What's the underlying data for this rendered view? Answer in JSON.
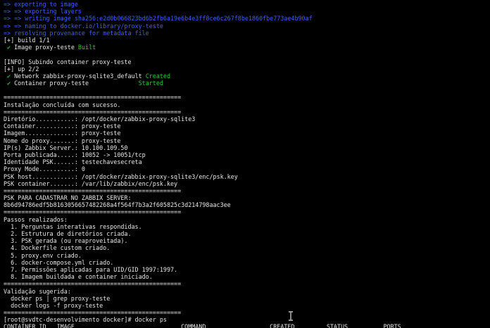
{
  "terminal": {
    "lines": [
      {
        "segments": [
          {
            "t": "=> exporting to image",
            "c": "blue"
          }
        ]
      },
      {
        "segments": [
          {
            "t": "=> => exporting layers",
            "c": "blue"
          }
        ]
      },
      {
        "segments": [
          {
            "t": "=> => writing image sha256:e2d0b066823bd6b2fb6a19e6b4e3ff8ce6c267f8be1860fbe773ae4b90af",
            "c": "blue"
          }
        ]
      },
      {
        "segments": [
          {
            "t": "=> => naming to docker.io/library/proxy-teste",
            "c": "blue"
          }
        ]
      },
      {
        "segments": [
          {
            "t": "=> resolving provenance for metadata file",
            "c": "blue"
          }
        ]
      },
      {
        "segments": [
          {
            "t": "[+] build 1/1",
            "c": "white"
          }
        ]
      },
      {
        "segments": [
          {
            "t": " ✔ ",
            "c": "check"
          },
          {
            "t": "Image proxy-teste ",
            "c": "white"
          },
          {
            "t": "Built",
            "c": "green"
          }
        ]
      },
      {
        "segments": [
          {
            "t": "",
            "c": "white"
          }
        ]
      },
      {
        "segments": [
          {
            "t": "[INFO] Subindo container proxy-teste",
            "c": "white"
          }
        ]
      },
      {
        "segments": [
          {
            "t": "[+] up 2/2",
            "c": "white"
          }
        ]
      },
      {
        "segments": [
          {
            "t": " ✔ ",
            "c": "check"
          },
          {
            "t": "Network zabbix-proxy-sqlite3_default ",
            "c": "white"
          },
          {
            "t": "Created",
            "c": "green"
          }
        ]
      },
      {
        "segments": [
          {
            "t": " ✔ ",
            "c": "check"
          },
          {
            "t": "Container proxy-teste              ",
            "c": "white"
          },
          {
            "t": "Started",
            "c": "green"
          }
        ]
      },
      {
        "segments": [
          {
            "t": "",
            "c": "white"
          }
        ]
      },
      {
        "segments": [
          {
            "t": "==================================================",
            "c": "white"
          }
        ]
      },
      {
        "segments": [
          {
            "t": "Instalação concluída com sucesso.",
            "c": "white"
          }
        ]
      },
      {
        "segments": [
          {
            "t": "==================================================",
            "c": "white"
          }
        ]
      },
      {
        "segments": [
          {
            "t": "Diretório...........: /opt/docker/zabbix-proxy-sqlite3",
            "c": "white"
          }
        ]
      },
      {
        "segments": [
          {
            "t": "Container...........: proxy-teste",
            "c": "white"
          }
        ]
      },
      {
        "segments": [
          {
            "t": "Imagem..............: proxy-teste",
            "c": "white"
          }
        ]
      },
      {
        "segments": [
          {
            "t": "Nome do proxy.......: proxy-teste",
            "c": "white"
          }
        ]
      },
      {
        "segments": [
          {
            "t": "IP(s) Zabbix Server.: 10.100.109.50",
            "c": "white"
          }
        ]
      },
      {
        "segments": [
          {
            "t": "Porta publicada.....: 10052 -> 10051/tcp",
            "c": "white"
          }
        ]
      },
      {
        "segments": [
          {
            "t": "Identidade PSK......: testechavesecreta",
            "c": "white"
          }
        ]
      },
      {
        "segments": [
          {
            "t": "Proxy Mode..........: 0",
            "c": "white"
          }
        ]
      },
      {
        "segments": [
          {
            "t": "PSK host............: /opt/docker/zabbix-proxy-sqlite3/enc/psk.key",
            "c": "white"
          }
        ]
      },
      {
        "segments": [
          {
            "t": "PSK container.......: /var/lib/zabbix/enc/psk.key",
            "c": "white"
          }
        ]
      },
      {
        "segments": [
          {
            "t": "==================================================",
            "c": "white"
          }
        ]
      },
      {
        "segments": [
          {
            "t": "PSK PARA CADASTRAR NO ZABBIX SERVER:",
            "c": "white"
          }
        ]
      },
      {
        "segments": [
          {
            "t": "8b6d94786edf5b8163056657482268a4f564f7b3a2f605825c3d214798aac3ee",
            "c": "white"
          }
        ]
      },
      {
        "segments": [
          {
            "t": "==================================================",
            "c": "white"
          }
        ]
      },
      {
        "segments": [
          {
            "t": "Passos realizados:",
            "c": "white"
          }
        ]
      },
      {
        "segments": [
          {
            "t": "  1. Perguntas interativas respondidas.",
            "c": "white"
          }
        ]
      },
      {
        "segments": [
          {
            "t": "  2. Estrutura de diretórios criada.",
            "c": "white"
          }
        ]
      },
      {
        "segments": [
          {
            "t": "  3. PSK gerada (ou reaproveitada).",
            "c": "white"
          }
        ]
      },
      {
        "segments": [
          {
            "t": "  4. Dockerfile custom criado.",
            "c": "white"
          }
        ]
      },
      {
        "segments": [
          {
            "t": "  5. proxy.env criado.",
            "c": "white"
          }
        ]
      },
      {
        "segments": [
          {
            "t": "  6. docker-compose.yml criado.",
            "c": "white"
          }
        ]
      },
      {
        "segments": [
          {
            "t": "  7. Permissões aplicadas para UID/GID 1997:1997.",
            "c": "white"
          }
        ]
      },
      {
        "segments": [
          {
            "t": "  8. Imagem buildada e container iniciado.",
            "c": "white"
          }
        ]
      },
      {
        "segments": [
          {
            "t": "==================================================",
            "c": "white"
          }
        ]
      },
      {
        "segments": [
          {
            "t": "Validação sugerida:",
            "c": "white"
          }
        ]
      },
      {
        "segments": [
          {
            "t": "  docker ps | grep proxy-teste",
            "c": "white"
          }
        ]
      },
      {
        "segments": [
          {
            "t": "  docker logs -f proxy-teste",
            "c": "white"
          }
        ]
      },
      {
        "segments": [
          {
            "t": "==================================================",
            "c": "white"
          }
        ]
      },
      {
        "segments": [
          {
            "t": "[root@svdtc-desenvolvimento docker]# docker ps",
            "c": "white"
          }
        ]
      },
      {
        "segments": [
          {
            "t": "CONTAINER ID   IMAGE                              COMMAND                  CREATED         STATUS          PORTS",
            "c": "white"
          }
        ]
      }
    ]
  },
  "colors": {
    "background": "#000000",
    "text": "#c9c9c9",
    "blue": "#3f5ff0",
    "green": "#36c43a"
  },
  "icons": {
    "mouse_cursor": "text-ibeam-cursor-icon",
    "status_check": "check-mark-icon"
  }
}
